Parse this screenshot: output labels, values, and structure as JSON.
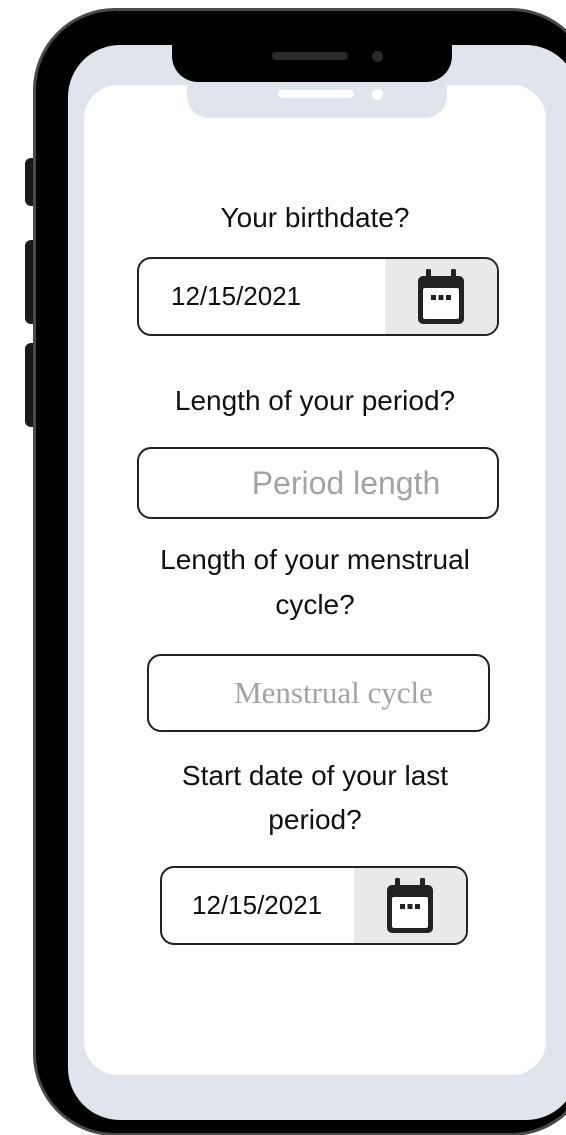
{
  "form": {
    "birthdate": {
      "label": "Your birthdate?",
      "value": "12/15/2021",
      "button_icon": "calendar-icon"
    },
    "period_length": {
      "label": "Length of your period?",
      "placeholder": "Period length"
    },
    "cycle_length": {
      "label_line1": "Length of your menstrual",
      "label_line2": "cycle?",
      "placeholder": "Menstrual cycle"
    },
    "last_period_start": {
      "label_line1": "Start date of your last",
      "label_line2": "period?",
      "value": "12/15/2021",
      "button_icon": "calendar-icon"
    }
  },
  "colors": {
    "phone_frame": "#000000",
    "screen_bezel": "#dfe4ed",
    "screen": "#ffffff",
    "field_border": "#222222",
    "placeholder": "#a3a3a3",
    "calendar_button_bg": "#e9e9e9"
  }
}
